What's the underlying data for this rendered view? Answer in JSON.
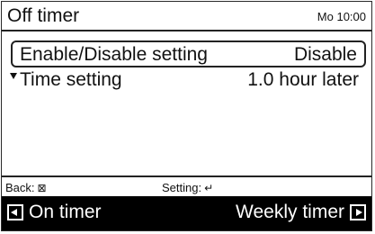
{
  "header": {
    "title": "Off timer",
    "clock": "Mo 10:00"
  },
  "settings": [
    {
      "label": "Enable/Disable setting",
      "value": "Disable",
      "selected": true
    },
    {
      "label": "Time setting",
      "value": "1.0 hour later",
      "selected": false
    }
  ],
  "footer_hints": {
    "back_label": "Back:",
    "back_icon": "cancel-box-icon",
    "setting_label": "Setting:",
    "setting_icon": "enter-return-icon"
  },
  "nav": {
    "prev_label": "On timer",
    "prev_icon": "page-prev-icon",
    "next_label": "Weekly timer",
    "next_icon": "page-next-icon"
  }
}
